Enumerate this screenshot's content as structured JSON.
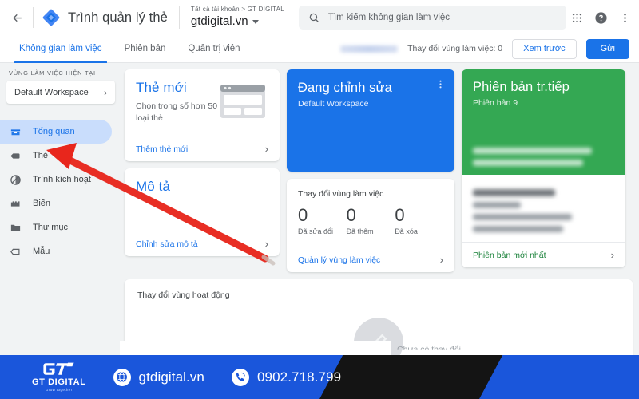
{
  "topbar": {
    "back_icon": "back-arrow-icon",
    "logo_icon": "gtm-diamond-logo",
    "app_title": "Trình quản lý thẻ",
    "account_breadcrumb": "Tất cả tài khoản > GT DIGITAL",
    "account_name": "gtdigital.vn",
    "search_icon": "search-icon",
    "search_placeholder": "Tìm kiếm không gian làm việc",
    "search_value": "",
    "apps_icon": "apps-grid-icon",
    "help_icon": "help-circle-icon",
    "more_icon": "more-vert-icon",
    "avatar_icon": "avatar"
  },
  "tabs": [
    {
      "label": "Không gian làm việc",
      "active": true
    },
    {
      "label": "Phiên bản",
      "active": false
    },
    {
      "label": "Quản trị viên",
      "active": false
    }
  ],
  "tab_actions": {
    "redacted_label": "",
    "changes_count": "Thay đổi vùng làm việc: 0",
    "preview_label": "Xem trước",
    "submit_label": "Gửi"
  },
  "sidebar": {
    "section_label": "VÙNG LÀM VIỆC HIỆN TẠI",
    "workspace_name": "Default Workspace",
    "workspace_chevron": "chevron-right-icon",
    "items": [
      {
        "label": "Tổng quan",
        "icon": "overview-icon",
        "active": true
      },
      {
        "label": "Thẻ",
        "icon": "tag-icon",
        "active": false
      },
      {
        "label": "Trình kích hoạt",
        "icon": "trigger-icon",
        "active": false
      },
      {
        "label": "Biến",
        "icon": "variable-icon",
        "active": false
      },
      {
        "label": "Thư mục",
        "icon": "folder-icon",
        "active": false
      },
      {
        "label": "Mẫu",
        "icon": "template-icon",
        "active": false
      }
    ]
  },
  "cards": {
    "new_tag": {
      "title": "Thẻ mới",
      "subtitle": "Chọn trong số hơn 50 loại thẻ",
      "illustration_icon": "browser-window-illustration",
      "footer_label": "Thêm thẻ mới",
      "footer_chevron": "chevron-right-icon"
    },
    "description": {
      "title": "Mô tả",
      "footer_label": "Chỉnh sửa mô tả",
      "footer_chevron": "chevron-right-icon"
    },
    "editing": {
      "title": "Đang chỉnh sửa",
      "subtitle": "Default Workspace",
      "menu_icon": "more-vert-icon"
    },
    "workspace_changes": {
      "heading": "Thay đổi vùng làm việc",
      "stats": [
        {
          "value": "0",
          "label": "Đã sửa đổi"
        },
        {
          "value": "0",
          "label": "Đã thêm"
        },
        {
          "value": "0",
          "label": "Đã xóa"
        }
      ],
      "footer_label": "Quản lý vùng làm việc",
      "footer_chevron": "chevron-right-icon"
    },
    "live_version": {
      "title": "Phiên bản tr.tiếp",
      "subtitle": "Phiên bản 9",
      "footer_label": "Phiên bản mới nhất",
      "footer_chevron": "chevron-right-icon"
    },
    "activity": {
      "title": "Thay đổi vùng hoạt động",
      "empty_icon": "pencil-edit-icon",
      "empty_text": "Chưa có thay đổi"
    }
  },
  "annotation": {
    "arrow_icon": "red-arrow-pointer",
    "arrow_color": "#e8261c"
  },
  "banner": {
    "logo_mark_icon": "gt-monogram-icon",
    "brand_name": "GT DIGITAL",
    "tagline": "Grow together",
    "website_icon": "globe-icon",
    "website": "gtdigital.vn",
    "phone_icon": "phone-call-icon",
    "phone": "0902.718.799",
    "bg_color": "#1a56db",
    "stripe_color": "#141414"
  }
}
